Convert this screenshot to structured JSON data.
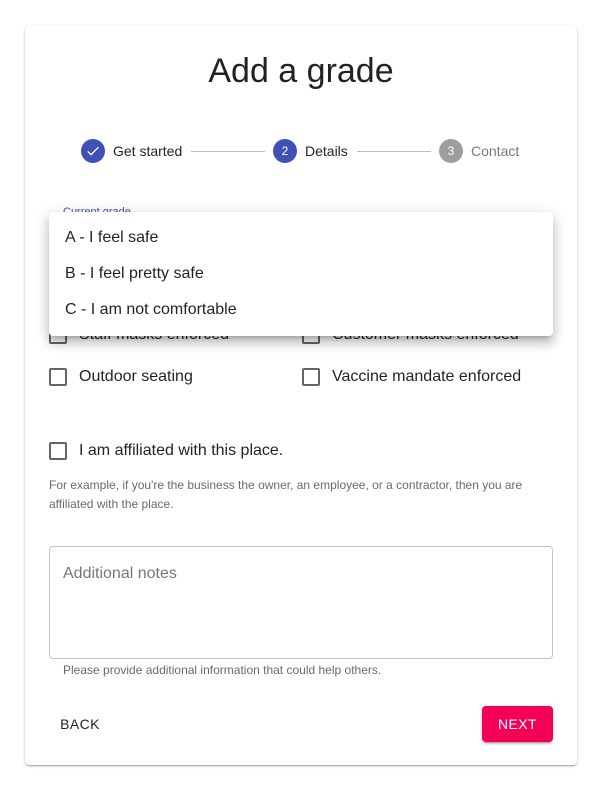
{
  "colors": {
    "primary": "#3f51b5",
    "secondary": "#f50057",
    "inactive_step": "#9e9e9e"
  },
  "title": "Add a grade",
  "stepper": {
    "steps": [
      {
        "label": "Get started",
        "number": "",
        "state": "completed",
        "icon": "check-icon"
      },
      {
        "label": "Details",
        "number": "2",
        "state": "active"
      },
      {
        "label": "Contact",
        "number": "3",
        "state": "inactive"
      }
    ]
  },
  "grade_select": {
    "label": "Current grade",
    "options": [
      "A - I feel safe",
      "B - I feel pretty safe",
      "C - I am not comfortable"
    ]
  },
  "checkboxes": {
    "staff_masks": "Staff masks enforced",
    "customer_masks": "Customer masks enforced",
    "outdoor_seating": "Outdoor seating",
    "vaccine_mandate": "Vaccine mandate enforced",
    "affiliated": "I am affiliated with this place."
  },
  "affiliation_helper": "For example, if you're the business the owner, an employee, or a contractor, then you are affiliated with the place.",
  "notes": {
    "placeholder": "Additional notes",
    "helper": "Please provide additional information that could help others."
  },
  "buttons": {
    "back": "BACK",
    "next": "NEXT"
  }
}
